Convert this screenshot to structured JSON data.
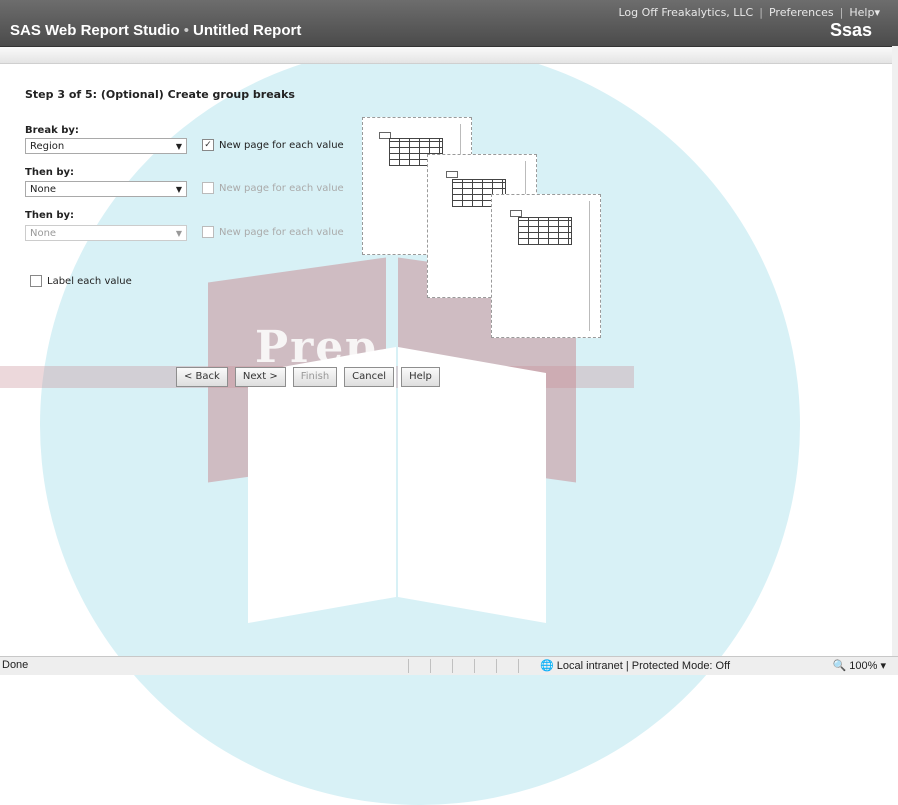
{
  "header": {
    "app_title": "SAS Web Report Studio",
    "separator": "•",
    "report_title": "Untitled Report",
    "links": [
      "Log Off Freakalytics, LLC",
      "Preferences",
      "Help▾"
    ],
    "logo": "Ssas"
  },
  "wizard": {
    "step_title": "Step 3 of 5: (Optional) Create group breaks",
    "break_by": {
      "label": "Break by:",
      "value": "Region",
      "checkbox_label": "New page for each value",
      "checked": true
    },
    "then_by_1": {
      "label": "Then by:",
      "value": "None",
      "checkbox_label": "New page for each value",
      "checked": false
    },
    "then_by_2": {
      "label": "Then by:",
      "value": "None",
      "checkbox_label": "New page for each value",
      "checked": false
    },
    "label_each_value": {
      "label": "Label each value",
      "checked": false
    }
  },
  "buttons": {
    "back": "< Back",
    "next": "Next >",
    "finish": "Finish",
    "cancel": "Cancel",
    "help": "Help"
  },
  "watermark": {
    "text": "Prep"
  },
  "statusbar": {
    "status": "Done",
    "zone": "Local intranet | Protected Mode: Off",
    "zoom": "100%"
  },
  "icons": {
    "dropdown": "chevron-down-icon",
    "check": "checkmark-icon",
    "globe": "globe-icon",
    "zoom": "magnifier-icon"
  }
}
